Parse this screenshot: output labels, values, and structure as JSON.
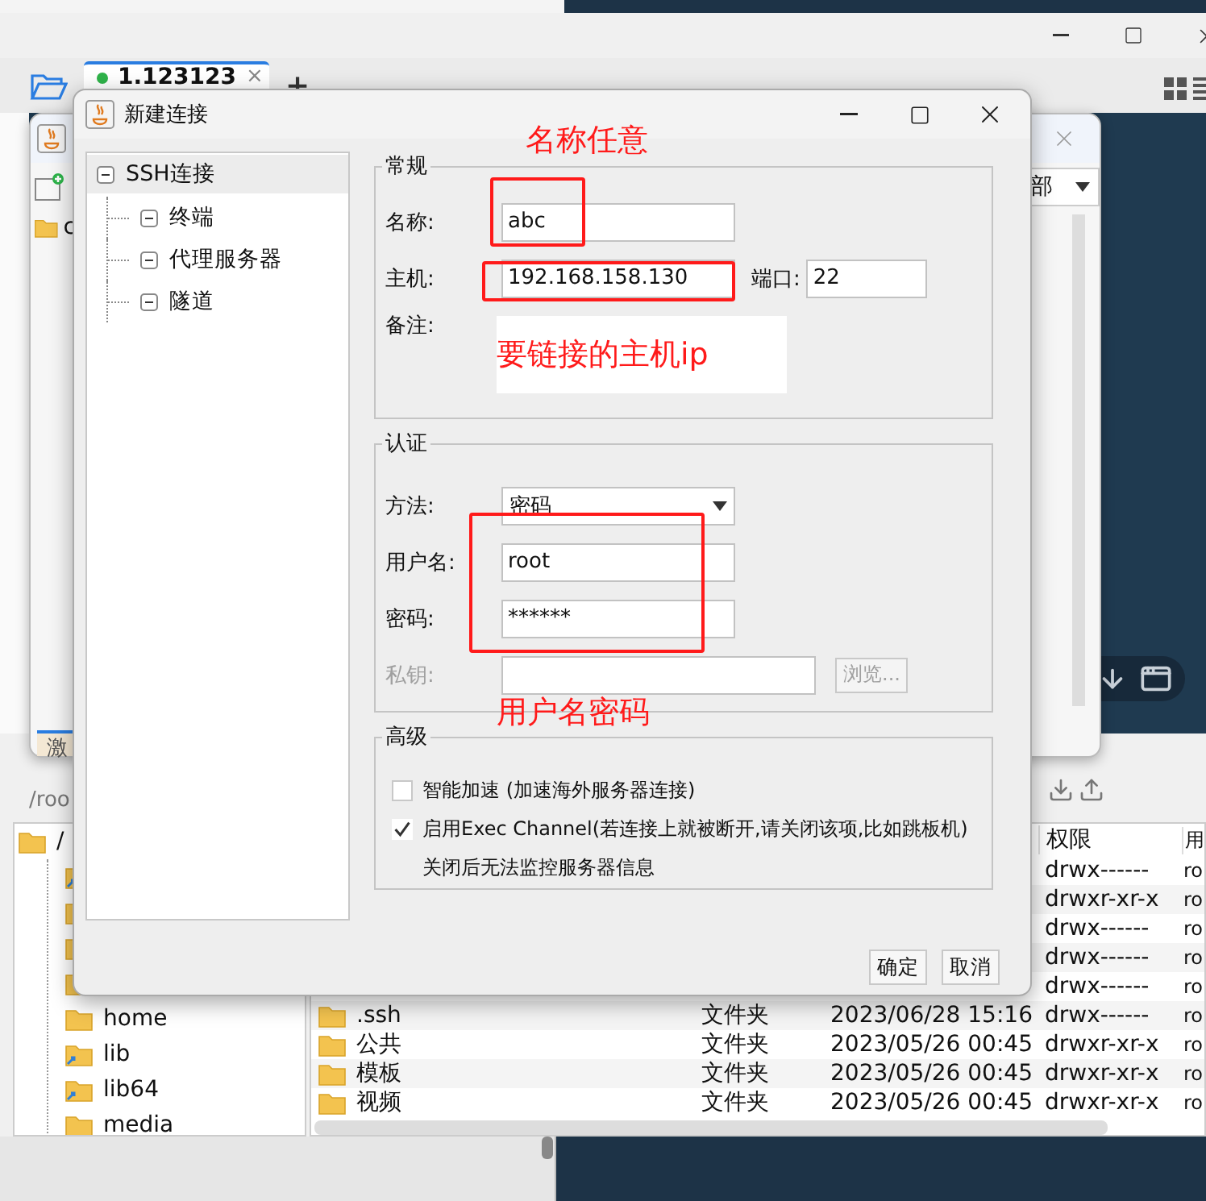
{
  "app": {
    "tab": {
      "label": "1.123123",
      "selected": true
    },
    "tab_close": "×",
    "new_tab": "+"
  },
  "session_manager": {
    "tree_root": "c",
    "dropdown_value": "部",
    "bottom_tab": "激"
  },
  "file_browser": {
    "path": "/roo",
    "tree": [
      {
        "label": "/",
        "kind": "folder",
        "children": [
          {
            "kind": "link_folder"
          },
          {
            "kind": "folder"
          },
          {
            "kind": "folder"
          },
          {
            "kind": "folder"
          },
          {
            "kind": "folder",
            "label": "home"
          },
          {
            "kind": "link_folder",
            "label": "lib"
          },
          {
            "kind": "link_folder",
            "label": "lib64"
          },
          {
            "kind": "folder",
            "label": "media"
          }
        ]
      }
    ],
    "columns": [
      {
        "kind": "name"
      },
      {
        "kind": "type"
      },
      {
        "kind": "date"
      },
      {
        "kind": "perms",
        "label": "权限"
      },
      {
        "kind": "owner",
        "label": "用"
      }
    ],
    "rows": [
      {
        "perms": "drwx------",
        "owner": "ro"
      },
      {
        "perms": "drwxr-xr-x",
        "owner": "ro"
      },
      {
        "perms": "drwx------",
        "owner": "ro"
      },
      {
        "perms": "drwx------",
        "owner": "ro"
      },
      {
        "perms": "drwx------",
        "owner": "ro"
      },
      {
        "name": ".ssh",
        "type": "文件夹",
        "date": "2023/06/28 15:16",
        "perms": "drwx------",
        "owner": "ro"
      },
      {
        "name": "公共",
        "type": "文件夹",
        "date": "2023/05/26 00:45",
        "perms": "drwxr-xr-x",
        "owner": "ro"
      },
      {
        "name": "模板",
        "type": "文件夹",
        "date": "2023/05/26 00:45",
        "perms": "drwxr-xr-x",
        "owner": "ro"
      },
      {
        "name": "视频",
        "type": "文件夹",
        "date": "2023/05/26 00:45",
        "perms": "drwxr-xr-x",
        "owner": "ro"
      }
    ]
  },
  "dialog": {
    "title": "新建连接",
    "nav": [
      {
        "label": "SSH连接",
        "selected": true,
        "children": [
          {
            "label": "终端",
            "selected": false
          },
          {
            "label": "代理服务器",
            "selected": false
          },
          {
            "label": "隧道",
            "selected": false
          }
        ]
      }
    ],
    "general": {
      "title": "常规",
      "name_label": "名称:",
      "name_value": "abc",
      "host_label": "主机:",
      "host_value": "192.168.158.130",
      "port_label": "端口:",
      "port_value": "22",
      "note_label": "备注:"
    },
    "auth": {
      "title": "认证",
      "method_label": "方法:",
      "method_value": "密码",
      "user_label": "用户名:",
      "user_value": "root",
      "password_label": "密码:",
      "password_value": "******",
      "key_label": "私钥:",
      "key_disabled": true,
      "browse": "浏览...",
      "browse_disabled": true
    },
    "advanced": {
      "title": "高级",
      "options": [
        {
          "label": "智能加速 (加速海外服务器连接)",
          "checked": false
        },
        {
          "label": "启用Exec Channel(若连接上就被断开,请关闭该项,比如跳板机)",
          "checked": true
        }
      ],
      "note": "关闭后无法监控服务器信息"
    },
    "buttons": [
      "确定",
      "取消"
    ]
  },
  "annotations": [
    {
      "kind": "label",
      "text": "名称任意"
    },
    {
      "kind": "frame"
    },
    {
      "kind": "frame"
    },
    {
      "kind": "boxed_label",
      "text": "要链接的主机ip"
    },
    {
      "kind": "frame"
    },
    {
      "kind": "label",
      "text": "用户名密码"
    }
  ]
}
